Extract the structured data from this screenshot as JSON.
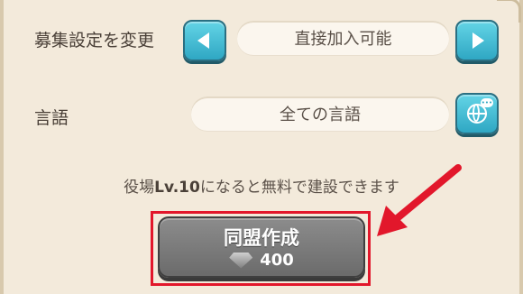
{
  "recruit": {
    "label": "募集設定を変更",
    "value": "直接加入可能"
  },
  "language": {
    "label": "言語",
    "value": "全ての言語"
  },
  "info": {
    "prefix": "役場",
    "level": "Lv.10",
    "suffix": "になると無料で建設できます"
  },
  "create_button": {
    "label": "同盟作成",
    "cost": "400",
    "cost_icon": "diamond-icon"
  },
  "colors": {
    "accent": "#2fa7c3",
    "highlight": "#e2172b",
    "button_disabled": "#7a7a7a"
  }
}
